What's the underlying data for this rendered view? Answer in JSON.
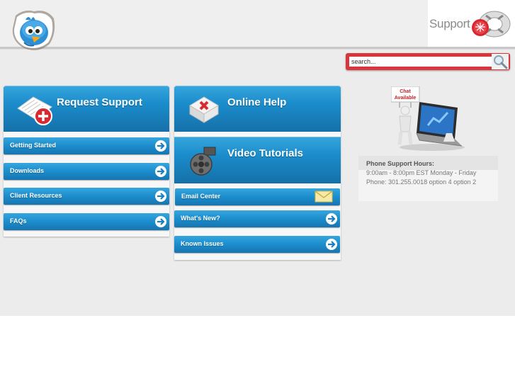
{
  "header": {
    "support_label": "Support"
  },
  "search": {
    "value": "search..."
  },
  "request_support": {
    "title": "Request Support",
    "items": [
      {
        "label": "Getting Started"
      },
      {
        "label": "Downloads"
      },
      {
        "label": "Client Resources"
      },
      {
        "label": "FAQs"
      }
    ]
  },
  "online_help": {
    "title": "Online Help"
  },
  "video_tutorials": {
    "title": "Video Tutorials",
    "items": [
      {
        "label": "Email Center"
      },
      {
        "label": "What's New?"
      },
      {
        "label": "Known Issues"
      }
    ]
  },
  "chat": {
    "sign_line1": "Chat",
    "sign_line2": "Available"
  },
  "phone_support": {
    "title": "Phone Support Hours:",
    "hours": "9:00am - 8:00pm EST Monday - Friday",
    "phone": "Phone: 301.255.0018 option 4 option 2"
  },
  "colors": {
    "accent_blue": "#1a8ccb",
    "search_red": "#d9353d"
  }
}
